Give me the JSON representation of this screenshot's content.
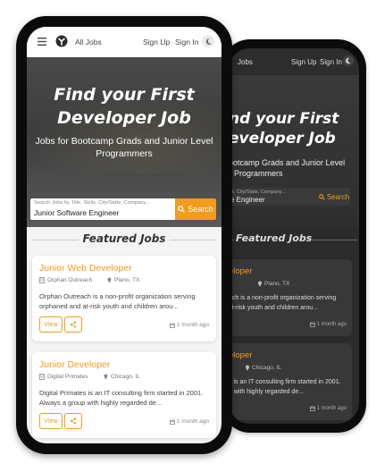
{
  "nav": {
    "all_jobs": "All Jobs",
    "sign_up": "Sign Up",
    "sign_in": "Sign In"
  },
  "hero": {
    "title_line1": "Find your First",
    "title_line2": "Developer Job",
    "subtitle_line1": "Jobs for Bootcamp Grads and Junior Level",
    "subtitle_line2": "Programmers",
    "search_placeholder": "Search Jobs by Title, Skills, City/State, Company...",
    "search_value": "Junior Software Engineer",
    "search_button": "Search"
  },
  "featured": {
    "heading": "Featured Jobs"
  },
  "jobs": [
    {
      "title": "Junior Web Developer",
      "company": "Orphan Outreach",
      "location": "Plano, TX",
      "description_line1": "Orphan Outreach is a non-profit organization serving",
      "description_line2": "orphaned and at-risk youth and children arou...",
      "view": "View",
      "posted": "1 month ago"
    },
    {
      "title": "Junior Developer",
      "company": "Digital Primates",
      "location": "Chicago, IL",
      "description_line1": "Digital Primates is an IT consulting firm started in 2001.",
      "description_line2": "Always a group with highly regarded de...",
      "view": "View",
      "posted": "1 month ago"
    }
  ],
  "dark": {
    "nav_jobs": "Jobs",
    "sign_up": "Sign Up",
    "sign_in": "Sign In",
    "title_line1": "nd your First",
    "title_line2": "eveloper Job",
    "subtitle_line1": "ootcamp Grads and Junior Level",
    "subtitle_line2": "Programmers",
    "search_placeholder": "ls, City/State, Company...",
    "search_value": "e Engineer",
    "search_button": "Search",
    "featured_heading": "Featured Jobs",
    "card1_title": "eloper",
    "card1_meta": "Plano, TX",
    "card1_desc_line1": "ach is a non-profit organization serving",
    "card1_desc_line2": "at-risk youth and children arou...",
    "card1_posted": "1 month ago",
    "card2_title": "eloper",
    "card2_meta": "Chicago, IL",
    "card2_desc_line1": "s is an IT consulting firm started in 2001.",
    "card2_desc_line2": "p with highly regarded de...",
    "card2_posted": "1 month ago"
  },
  "colors": {
    "accent": "#f29b1d",
    "dark_bg": "#2b2b2b"
  }
}
